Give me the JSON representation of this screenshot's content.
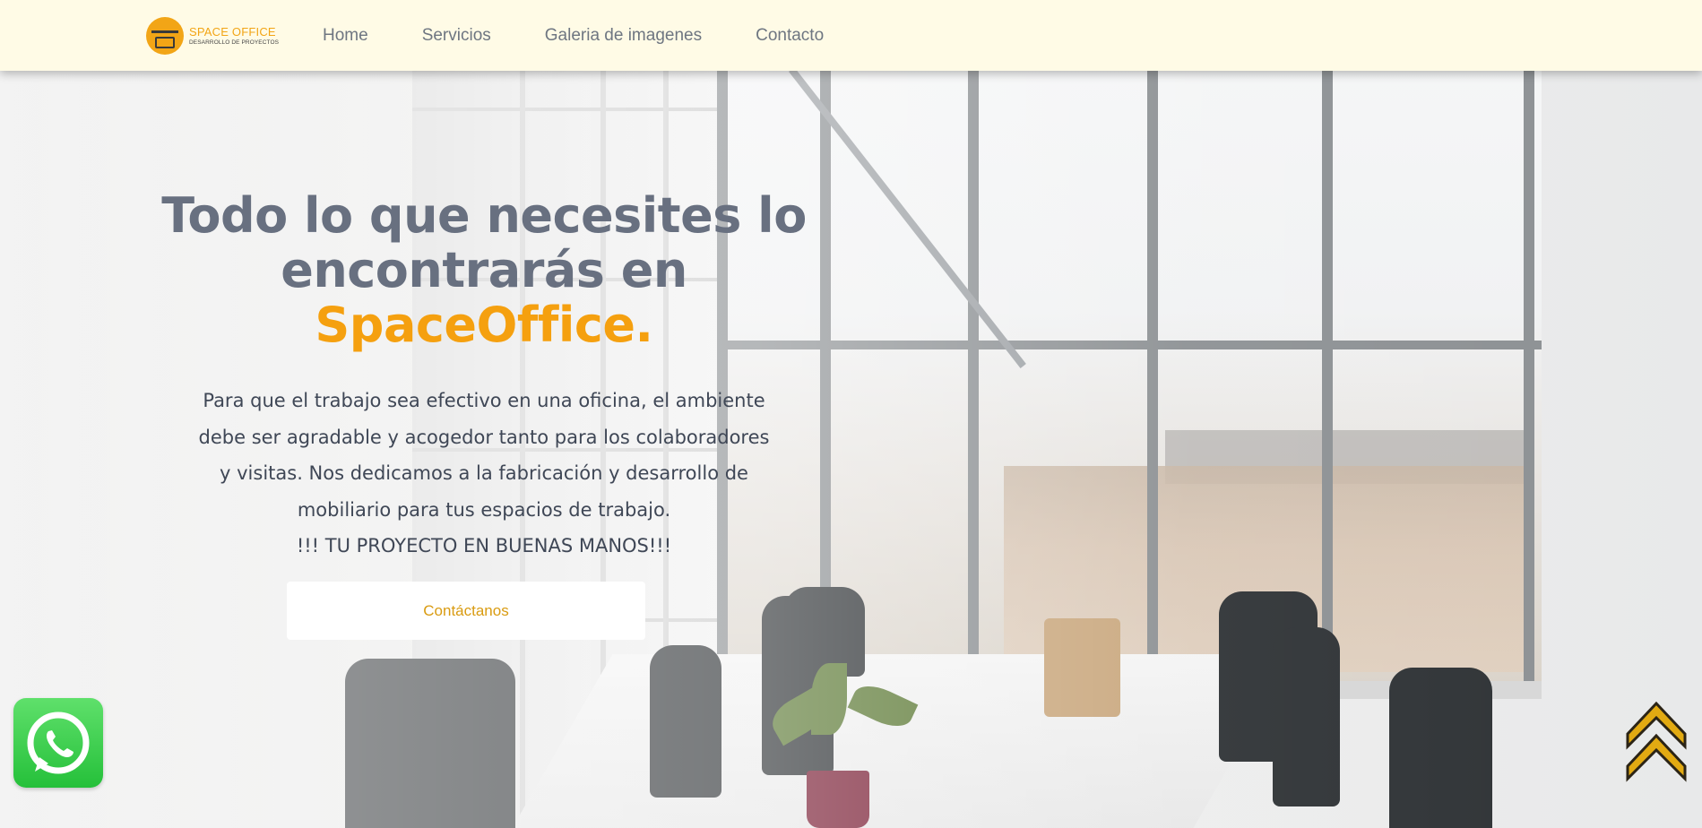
{
  "nav": {
    "logo": {
      "title": "SPACE OFFICE",
      "subtitle": "DESARROLLO DE PROYECTOS"
    },
    "links": [
      {
        "label": "Home"
      },
      {
        "label": "Servicios"
      },
      {
        "label": "Galeria de imagenes"
      },
      {
        "label": "Contacto"
      }
    ]
  },
  "hero": {
    "headline_line1": "Todo lo que necesites lo",
    "headline_line2": "encontrarás en",
    "headline_brand": "SpaceOffice.",
    "description": "Para que el trabajo sea efectivo en una oficina, el ambiente debe ser agradable y acogedor tanto para los colaboradores y visitas. Nos dedicamos a la fabricación y desarrollo de mobiliario para tus espacios de trabajo.",
    "tagline": "!!! TU PROYECTO EN BUENAS MANOS!!!",
    "cta_label": "Contáctanos"
  },
  "floating": {
    "whatsapp_icon": "whatsapp-icon",
    "scroll_top_icon": "double-chevron-up-icon"
  },
  "colors": {
    "navbar_bg": "#fffbe6",
    "accent": "#f5a00f",
    "headline": "#687080",
    "body_text": "#3f4756",
    "nav_text": "#6e7681",
    "whatsapp_green": "#25c03a"
  }
}
